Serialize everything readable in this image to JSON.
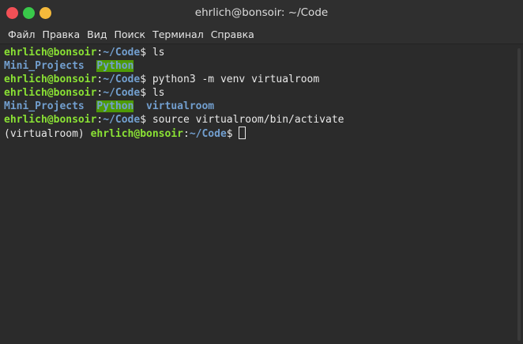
{
  "window": {
    "title": "ehrlich@bonsoir: ~/Code",
    "controls": {
      "close_color": "#f25056",
      "minimize_color": "#39c94a",
      "maximize_color": "#f4b93b"
    }
  },
  "menu": {
    "items": [
      "Файл",
      "Правка",
      "Вид",
      "Поиск",
      "Терминал",
      "Справка"
    ]
  },
  "terminal": {
    "colors": {
      "user": "#8ae234",
      "path": "#729fcf",
      "dir_highlight_bg": "#4e9a06",
      "text": "#e8e8e8",
      "background": "#2b2b2b"
    },
    "prompt_user": "ehrlich@bonsoir",
    "prompt_sep": ":",
    "prompt_path": "~/Code",
    "prompt_dollar": "$",
    "lines": {
      "l1_cmd": " ls",
      "l2_dir1": "Mini_Projects",
      "l2_dir2": "Python",
      "l3_cmd": " python3 -m venv virtualroom",
      "l4_cmd": " ls",
      "l5_dir1": "Mini_Projects",
      "l5_dir2": "Python",
      "l5_dir3": "virtualroom",
      "l6_cmd": " source virtualroom/bin/activate",
      "l7_venv": "(virtualroom) "
    }
  }
}
